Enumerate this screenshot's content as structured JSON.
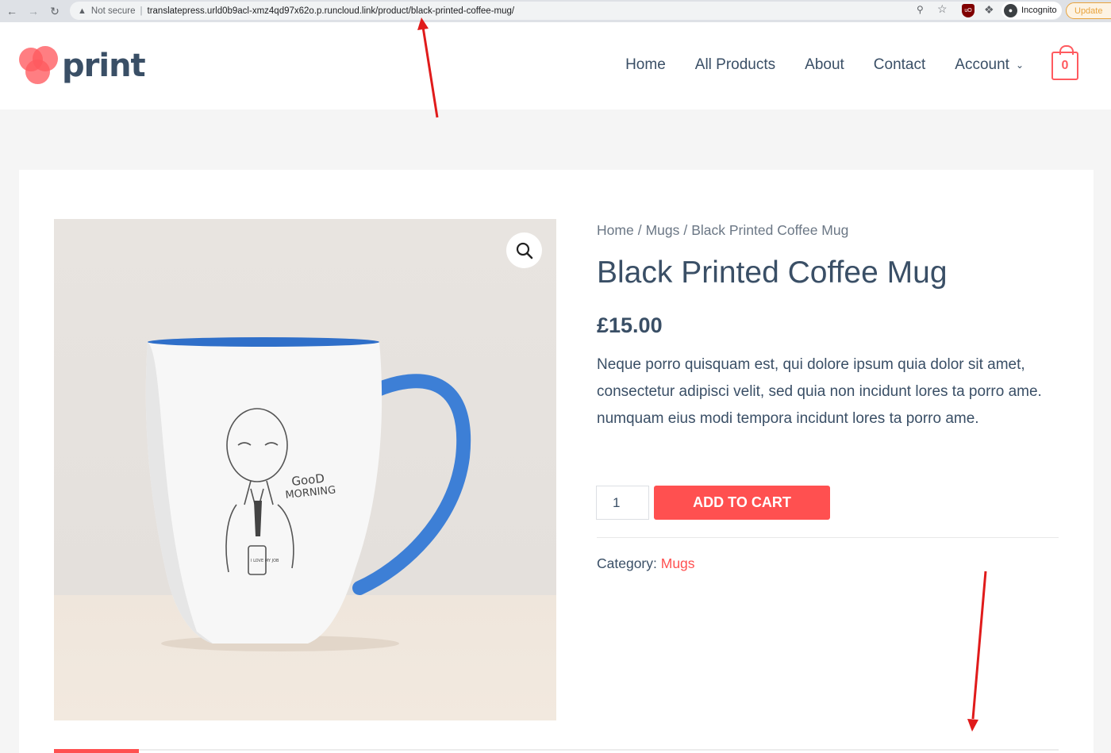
{
  "browser": {
    "security_label": "Not secure",
    "url": "translatepress.urld0b9acl-xmz4qd97x62o.p.runcloud.link/product/black-printed-coffee-mug/",
    "incognito_label": "Incognito",
    "update_label": "Update"
  },
  "site": {
    "logo_text": "print",
    "nav": {
      "home": "Home",
      "all_products": "All Products",
      "about": "About",
      "contact": "Contact",
      "account": "Account"
    },
    "cart_count": "0"
  },
  "product": {
    "breadcrumb": {
      "home": "Home",
      "category": "Mugs",
      "current": "Black Printed Coffee Mug",
      "separator": "/"
    },
    "title": "Black Printed Coffee Mug",
    "price": "£15.00",
    "description": "Neque porro quisquam est, qui dolore ipsum quia dolor sit amet, consectetur adipisci velit, sed quia non incidunt lores ta porro ame. numquam eius modi tempora incidunt lores ta porro ame.",
    "quantity": "1",
    "add_to_cart_label": "ADD TO CART",
    "category_label": "Category:",
    "category_value": "Mugs",
    "mug_print": {
      "line1": "GooD",
      "line2": "MORNING",
      "cup_text": "I LOVE MY JOB"
    }
  },
  "colors": {
    "accent": "#ff5050",
    "text": "#3a4f66",
    "annotation_arrow": "#e01b1b"
  }
}
